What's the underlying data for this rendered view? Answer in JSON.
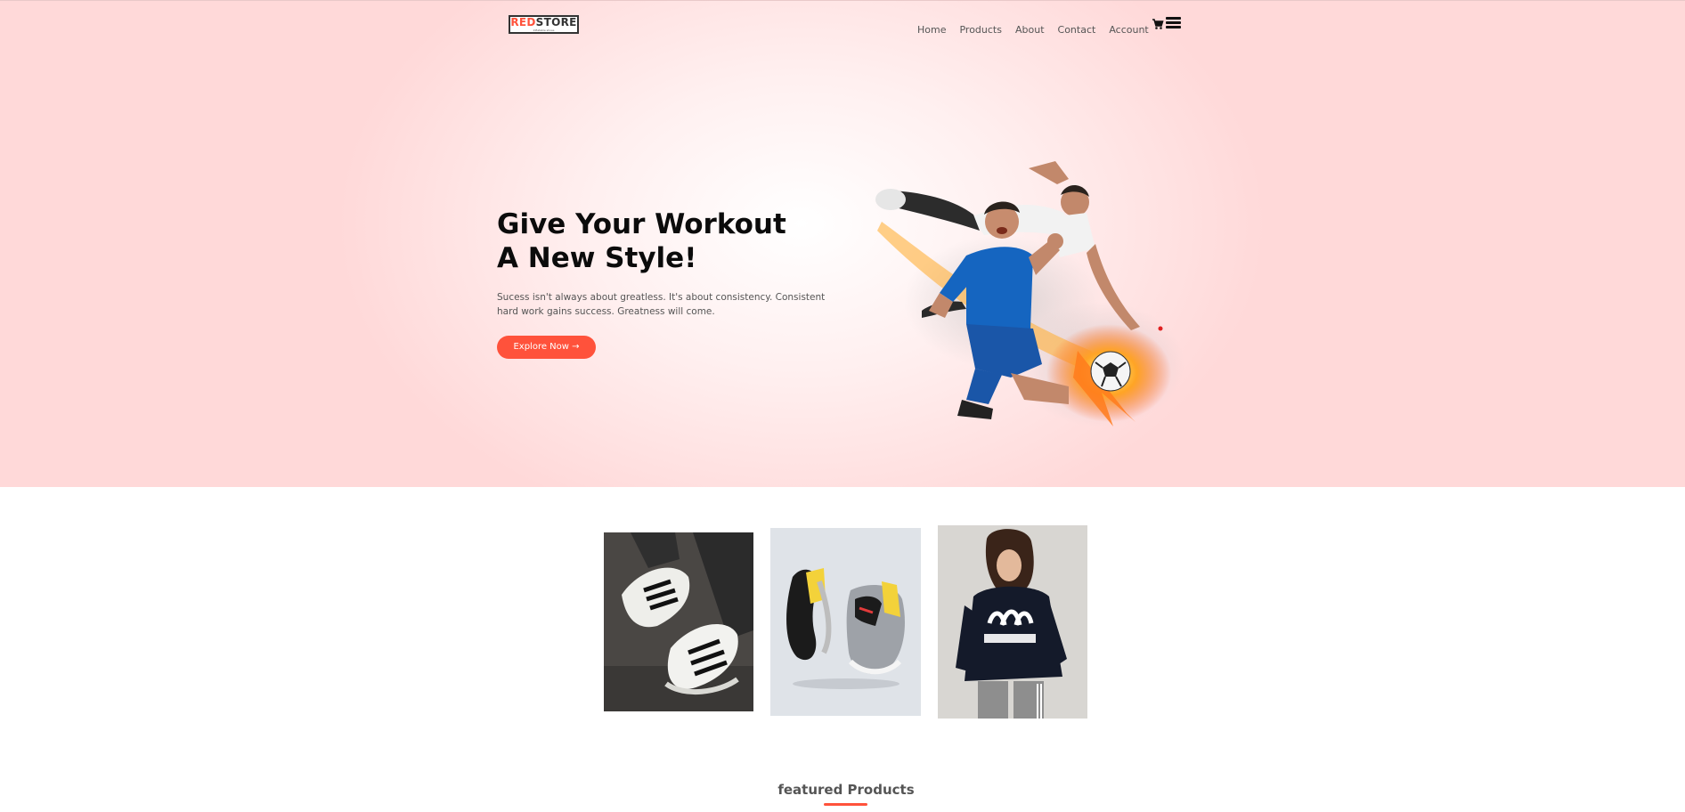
{
  "brand": {
    "name_part1": "RED",
    "name_part2": "STORE",
    "tagline": "Inflatable shoes"
  },
  "nav": {
    "items": [
      "Home",
      "Products",
      "About",
      "Contact",
      "Account"
    ]
  },
  "icons": {
    "cart": "cart-icon",
    "menu": "menu-icon"
  },
  "hero": {
    "title_line1": "Give Your Workout",
    "title_line2": "A New Style!",
    "desc_line1": "Sucess isn't always about greatless. It's about consistency. Consistent",
    "desc_line2": "hard work gains success. Greatness will come.",
    "button_label": "Explore Now →"
  },
  "categories": [
    {
      "image": "white sneakers on feet"
    },
    {
      "image": "pair of grey running shoes"
    },
    {
      "image": "woman in adidas hoodie"
    }
  ],
  "featured": {
    "title": "featured Products"
  },
  "colors": {
    "accent": "#ff523b",
    "hero_bg": "#ffd9d9",
    "text_dark": "#0b0b0b"
  }
}
